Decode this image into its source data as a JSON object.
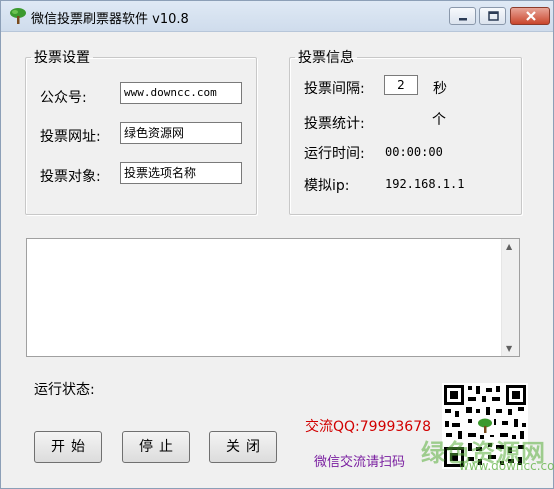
{
  "window": {
    "title": "微信投票刷票器软件 v10.8"
  },
  "settings": {
    "legend": "投票设置",
    "account_label": "公众号:",
    "account_value": "www.downcc.com",
    "url_label": "投票网址:",
    "url_value": "绿色资源网",
    "target_label": "投票对象:",
    "target_value": "投票选项名称"
  },
  "info": {
    "legend": "投票信息",
    "interval_label": "投票间隔:",
    "interval_value": "2",
    "interval_unit": "秒",
    "count_label": "投票统计:",
    "count_unit": "个",
    "runtime_label": "运行时间:",
    "runtime_value": "00:00:00",
    "ip_label": "模拟ip:",
    "ip_value": "192.168.1.1"
  },
  "status": {
    "label": "运行状态:"
  },
  "buttons": {
    "start": "开始",
    "stop": "停止",
    "close": "关闭"
  },
  "contact": {
    "qq": "交流QQ:79993678",
    "scan": "微信交流请扫码"
  },
  "watermark": {
    "brand": "绿色资源网",
    "url": "www.downcc.com"
  }
}
